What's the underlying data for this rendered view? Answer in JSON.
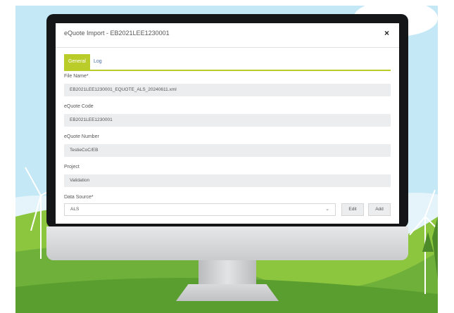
{
  "dialog": {
    "title": "eQuote Import - EB2021LEE1230001",
    "close_glyph": "×"
  },
  "tabs": [
    {
      "label": "General",
      "active": true
    },
    {
      "label": "Log",
      "active": false
    }
  ],
  "fields": [
    {
      "label": "File Name*",
      "value": "EB2021LEE1230001_EQUOTE_ALS_20240611.xml"
    },
    {
      "label": "eQuote Code",
      "value": "EB2021LEE1230001"
    },
    {
      "label": "eQuote Number",
      "value": "TestieCoC/EB"
    },
    {
      "label": "Project",
      "value": "Validation"
    }
  ],
  "data_source": {
    "label": "Data Source*",
    "value": "ALS",
    "edit_label": "Edit",
    "add_label": "Add"
  },
  "colors": {
    "accent": "#b9cc2a",
    "link": "#4a6fa5",
    "field_bg": "#ebedee"
  }
}
